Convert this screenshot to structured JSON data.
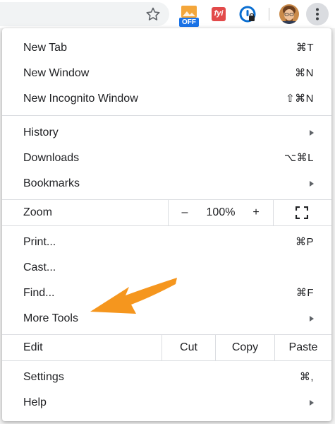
{
  "toolbar": {
    "bookmark_star_icon": "star-outline-icon",
    "extensions": [
      {
        "name": "image-extension",
        "badge": "OFF",
        "badge_color": "#1a73e8"
      },
      {
        "name": "fyi-extension",
        "text": "fyi",
        "color": "#e24a4a"
      },
      {
        "name": "password-manager-extension",
        "color": "#0a6ed1"
      }
    ]
  },
  "menu": {
    "new_tab": {
      "label": "New Tab",
      "shortcut": "⌘T"
    },
    "new_window": {
      "label": "New Window",
      "shortcut": "⌘N"
    },
    "new_incognito": {
      "label": "New Incognito Window",
      "shortcut": "⇧⌘N"
    },
    "history": {
      "label": "History"
    },
    "downloads": {
      "label": "Downloads",
      "shortcut": "⌥⌘L"
    },
    "bookmarks": {
      "label": "Bookmarks"
    },
    "zoom": {
      "label": "Zoom",
      "minus": "–",
      "value": "100%",
      "plus": "+"
    },
    "print": {
      "label": "Print...",
      "shortcut": "⌘P"
    },
    "cast": {
      "label": "Cast..."
    },
    "find": {
      "label": "Find...",
      "shortcut": "⌘F"
    },
    "more_tools": {
      "label": "More Tools"
    },
    "edit": {
      "label": "Edit",
      "cut": "Cut",
      "copy": "Copy",
      "paste": "Paste"
    },
    "settings": {
      "label": "Settings",
      "shortcut": "⌘,"
    },
    "help": {
      "label": "Help"
    }
  },
  "annotation": {
    "arrow_color": "#f5961e"
  }
}
